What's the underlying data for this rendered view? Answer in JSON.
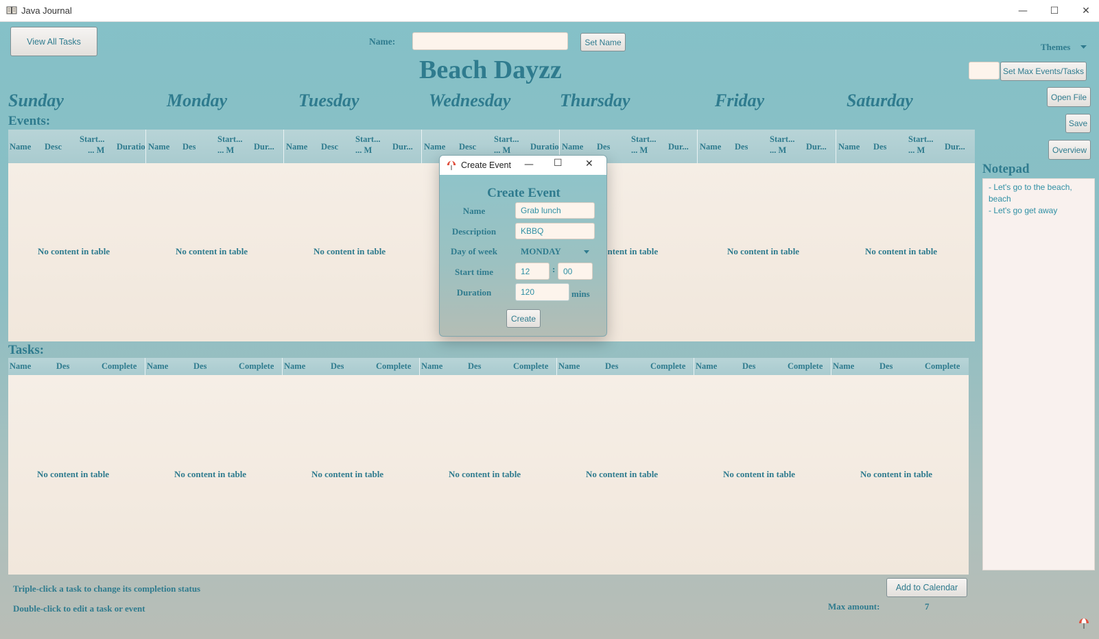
{
  "window": {
    "title": "Java Journal",
    "minimize": "—",
    "maximize": "☐",
    "close": "✕"
  },
  "toolbar": {
    "view_all_tasks": "View All Tasks",
    "name_label": "Name:",
    "name_value": "",
    "set_name": "Set Name",
    "themes": "Themes",
    "set_max": "Set Max Events/Tasks",
    "open_file": "Open File",
    "save": "Save",
    "overview": "Overview"
  },
  "heading": "Beach Dayzz",
  "days": [
    "Sunday",
    "Monday",
    "Tuesday",
    "Wednesday",
    "Thursday",
    "Friday",
    "Saturday"
  ],
  "events": {
    "title": "Events:",
    "columns": [
      [
        "Name",
        "Desc",
        "Start...\n... M",
        "Duratio"
      ],
      [
        "Name",
        "Des",
        "Start...\n... M",
        "Dur..."
      ],
      [
        "Name",
        "Desc",
        "Start...\n... M",
        "Dur..."
      ],
      [
        "Name",
        "Desc",
        "Start...\n... M",
        "Duratio"
      ],
      [
        "Name",
        "Des",
        "Start...\n... M",
        "Dur..."
      ],
      [
        "Name",
        "Des",
        "Start...\n... M",
        "Dur..."
      ],
      [
        "Name",
        "Des",
        "Start...\n... M",
        "Dur..."
      ]
    ],
    "empty": "No content in table",
    "empty_partial": "ontent in table"
  },
  "tasks": {
    "title": "Tasks:",
    "columns": [
      "Name",
      "Des",
      "Complete"
    ],
    "empty": "No content in table"
  },
  "notepad": {
    "title": "Notepad",
    "lines": [
      "- Let's go to the beach, beach",
      "- Let's go get away"
    ]
  },
  "footer": {
    "hint1": "Triple-click a task to change its completion status",
    "hint2": "Double-click to edit a task or event",
    "add_to_calendar": "Add to Calendar",
    "max_amount_label": "Max amount:",
    "max_amount_value": "7"
  },
  "dialog": {
    "window_title": "Create Event",
    "heading": "Create Event",
    "name_label": "Name",
    "name_value": "Grab lunch",
    "description_label": "Description",
    "description_value": "KBBQ",
    "day_label": "Day of week",
    "day_value": "MONDAY",
    "start_label": "Start time",
    "start_hour": "12",
    "start_sep": ":",
    "start_min": "00",
    "duration_label": "Duration",
    "duration_value": "120",
    "duration_unit": "mins",
    "create_button": "Create"
  }
}
